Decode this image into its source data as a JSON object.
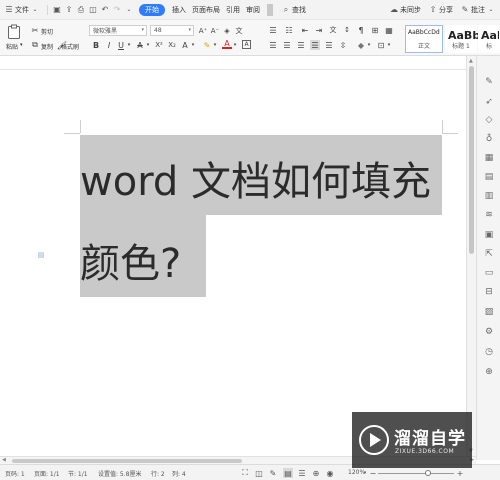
{
  "menu": {
    "file": "文件",
    "tabs": [
      "开始",
      "插入",
      "页面布局",
      "引用",
      "审阅"
    ],
    "active_tab_index": 0,
    "search": "查找",
    "sync": "未同步",
    "share": "分享",
    "annotate": "批注"
  },
  "ribbon": {
    "paste": "粘贴",
    "cut": "剪切",
    "copy": "复制",
    "format_painter": "格式刷",
    "font_name": "微软雅黑",
    "font_size": "48",
    "styles": [
      {
        "sample": "AaBbCcDd",
        "name": "正文"
      },
      {
        "sample": "AaBb",
        "name": "标题 1"
      },
      {
        "sample": "AaB",
        "name": "标"
      }
    ]
  },
  "document": {
    "line1": "word 文档如何填充",
    "line2": "颜色?",
    "highlight_color": "#c9c9c9"
  },
  "statusbar": {
    "page": "页码: 1",
    "pages": "页面: 1/1",
    "section": "节: 1/1",
    "position": "设置值: 5.8厘米",
    "row": "行: 2",
    "col": "列: 4",
    "zoom": "120%",
    "zoom_level": 0.66
  },
  "watermark": {
    "name": "溜溜自学",
    "url": "ZIXUE.3D66.COM"
  },
  "colors": {
    "accent": "#2e7dff",
    "text": "#2b2b2b"
  }
}
